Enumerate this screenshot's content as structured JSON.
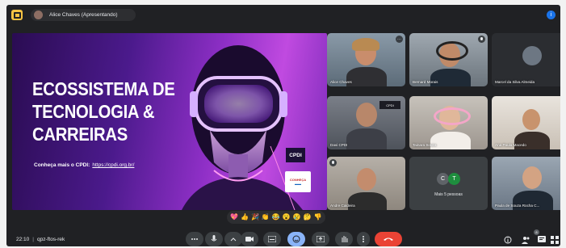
{
  "header": {
    "presenter_label": "Alice Chaves (Apresentando)"
  },
  "slide": {
    "title_lines": [
      "ECOSSISTEMA DE",
      "TECNOLOGIA &",
      "CARREIRAS"
    ],
    "subtitle": "Conheça mais o CPDI:",
    "link": "https://cpdi.org.br/",
    "logo_text": "CPDI",
    "partner_logo": "CONHEÇA"
  },
  "participants": [
    {
      "name": "Alice Chaves"
    },
    {
      "name": "Bernard Morais"
    },
    {
      "name": "Marcel da Silva Almeida"
    },
    {
      "name": "Davi CPDI"
    },
    {
      "name": "Tainara Souza"
    },
    {
      "name": "Ana Paula Macedo"
    },
    {
      "name": "Andre Caldeira"
    },
    {
      "name": "Paula de Souza Rocha C..."
    }
  ],
  "more_tile": {
    "label": "Mais 5 pessoas",
    "initials": [
      "C",
      "T"
    ]
  },
  "reactions": [
    "💖",
    "👍",
    "🎉",
    "👏",
    "😂",
    "😮",
    "😢",
    "🤔",
    "👎"
  ],
  "bottom_bar": {
    "time": "22:10",
    "meeting_code": "qpz-ftos-rek",
    "participant_count": "8"
  },
  "colors": {
    "background": "#202124",
    "control": "#3c4043",
    "active": "#8ab4f8",
    "end_call": "#ea4335",
    "slide_accent": "#8e2fc6"
  },
  "icons": [
    "more-options-icon",
    "mic-icon",
    "camera-icon",
    "captions-icon",
    "emoji-icon",
    "present-icon",
    "raise-hand-icon",
    "more-vert-icon",
    "end-call-icon",
    "info-icon",
    "people-icon",
    "chat-icon",
    "activities-icon"
  ]
}
